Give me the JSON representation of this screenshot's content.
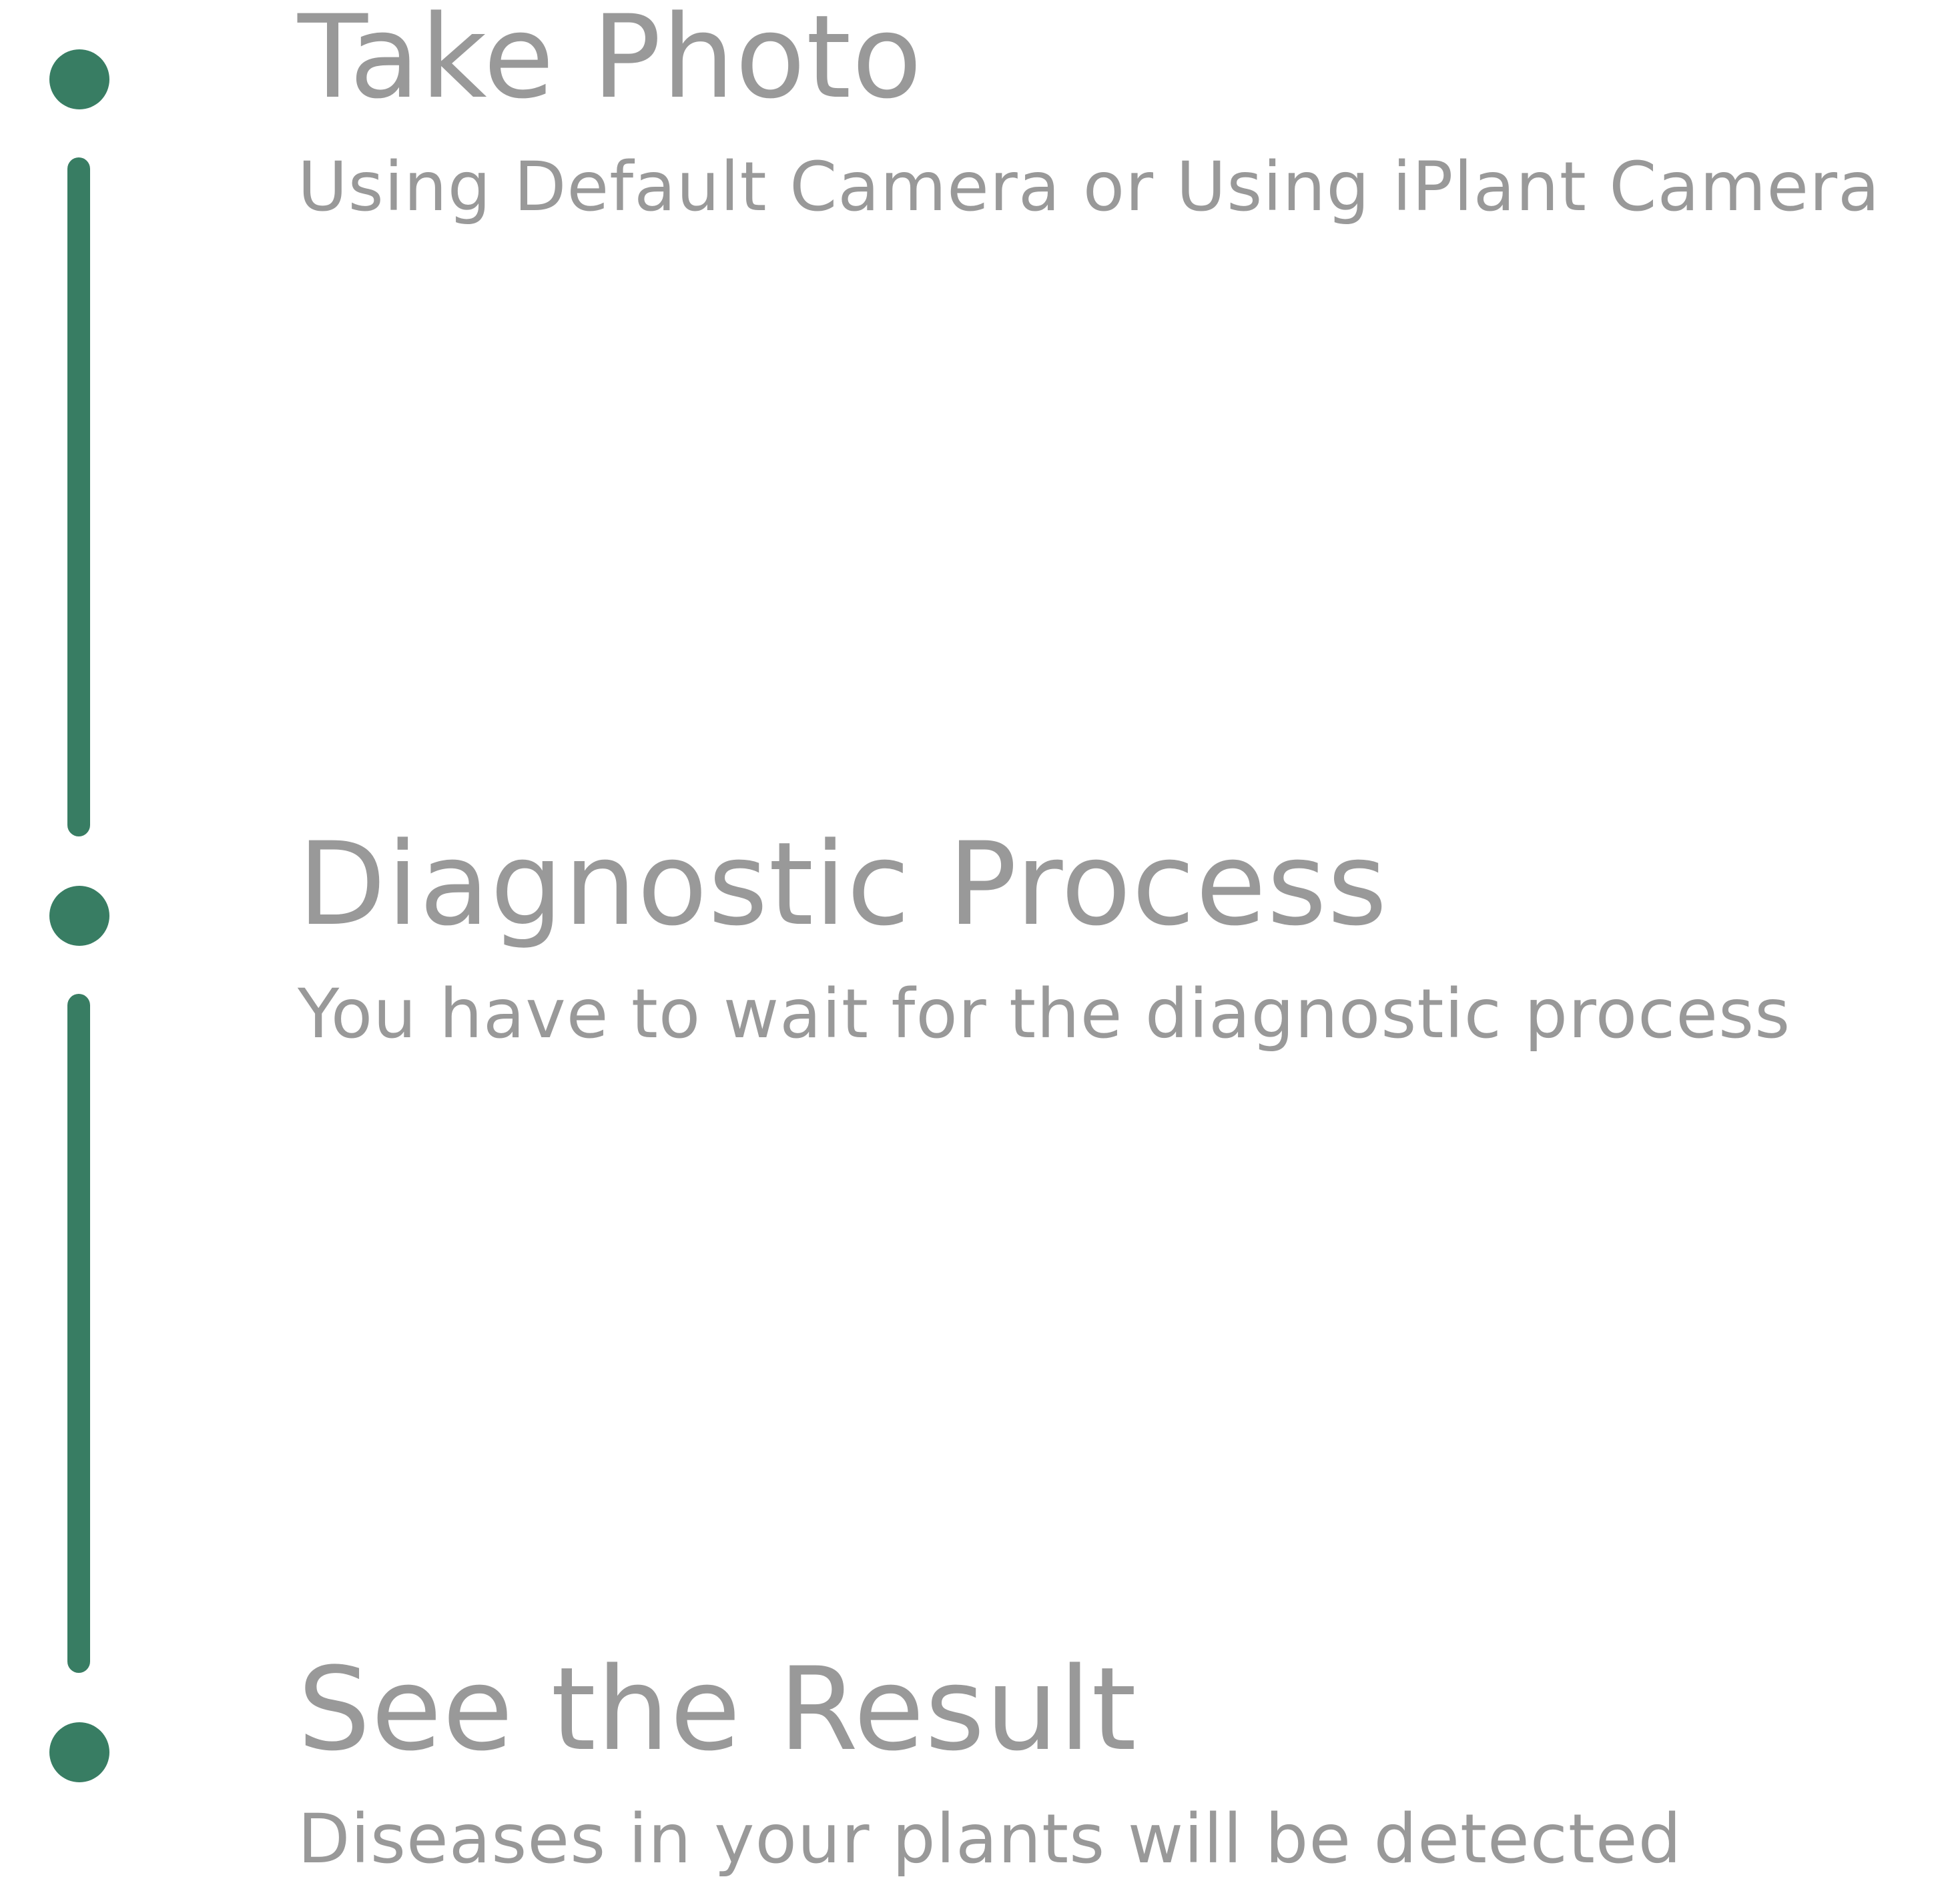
{
  "theme": {
    "accent": "#387d63",
    "text": "#999999",
    "background": "#ffffff"
  },
  "steps": [
    {
      "title": "Take Photo",
      "description": "Using Default Camera or Using iPlant Camera"
    },
    {
      "title": "Diagnostic Process",
      "description": "You have to wait for the diagnostic process"
    },
    {
      "title": "See the Result",
      "description": "Diseases in your plants will be detected"
    }
  ]
}
